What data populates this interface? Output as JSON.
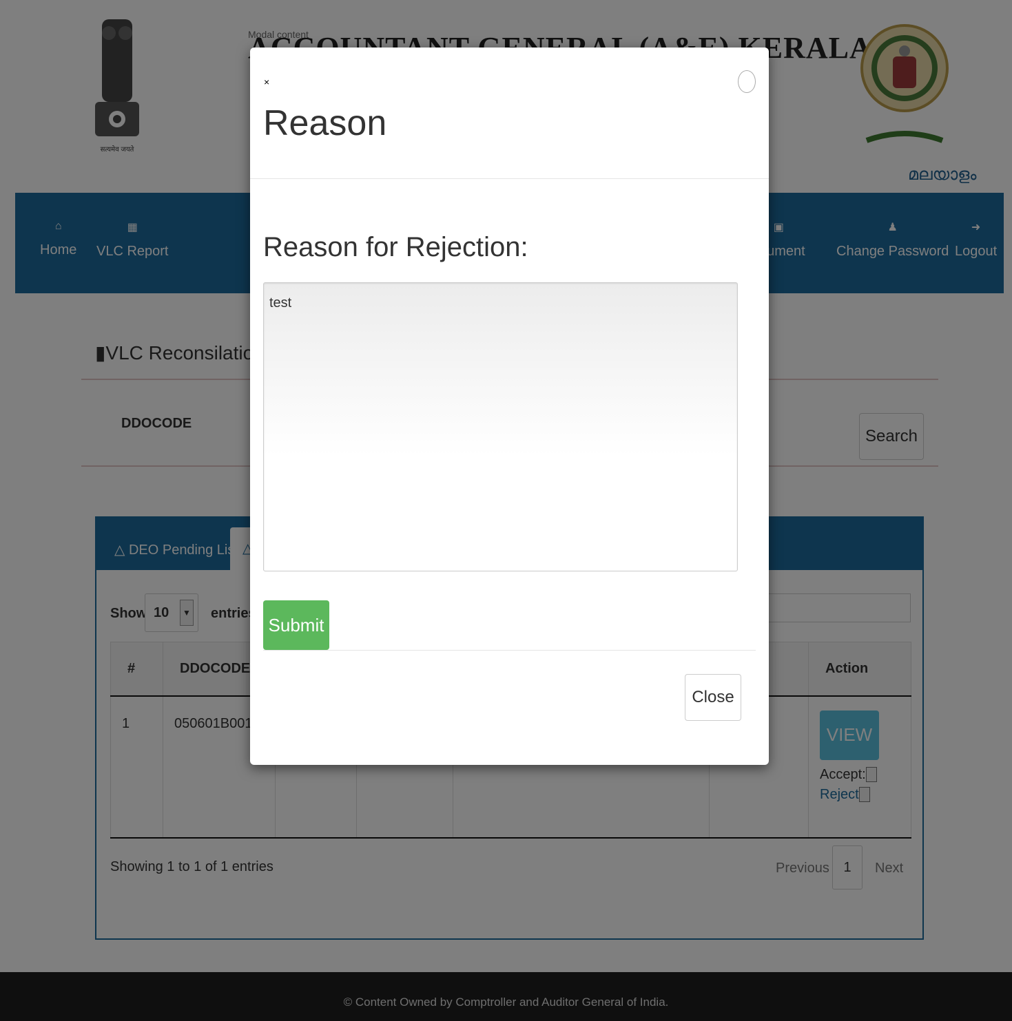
{
  "header": {
    "site_title": "ACCOUNTANT GENERAL (A&E) KERALA",
    "modal_content_label": "Modal content",
    "emblem_caption": "सत्यमेव जयते",
    "language_link": "മലയാളം"
  },
  "navbar": {
    "items": [
      {
        "label": "Home",
        "icon": "home-icon"
      },
      {
        "label": "VLC Report",
        "icon": "grid-icon"
      },
      {
        "label": "ocument",
        "icon": "pdf-icon"
      },
      {
        "label": "Change Password",
        "icon": "user-icon"
      },
      {
        "label": "Logout",
        "icon": "logout-icon"
      }
    ]
  },
  "main": {
    "section_title": "VLC Reconsilation",
    "ddocode_label": "DDOCODE",
    "search_label": "Search",
    "tabs": [
      {
        "label": "DEO Pending List"
      }
    ],
    "show_label": "Show",
    "page_length": "10",
    "entries_label": "entries",
    "table": {
      "columns": [
        "#",
        "DDOCODE",
        "",
        "",
        "",
        "",
        "Action"
      ],
      "rows": [
        {
          "index": "1",
          "ddocode": "050601B001",
          "view_label": "VIEW",
          "accept_label": "Accept:",
          "reject_label": "Reject"
        }
      ]
    },
    "info": "Showing 1 to 1 of 1 entries",
    "pagination": {
      "previous": "Previous",
      "current": "1",
      "next": "Next"
    }
  },
  "footer": {
    "text": "© Content Owned by Comptroller and Auditor General of India."
  },
  "modal": {
    "close_x": "×",
    "title": "Reason",
    "field_label": "Reason for Rejection:",
    "field_value": "test",
    "submit_label": "Submit",
    "close_label": "Close"
  },
  "colors": {
    "nav": "#1d6b9c",
    "submit": "#5cb85c",
    "view": "#5bc0de",
    "footer": "#1e1e1e"
  }
}
